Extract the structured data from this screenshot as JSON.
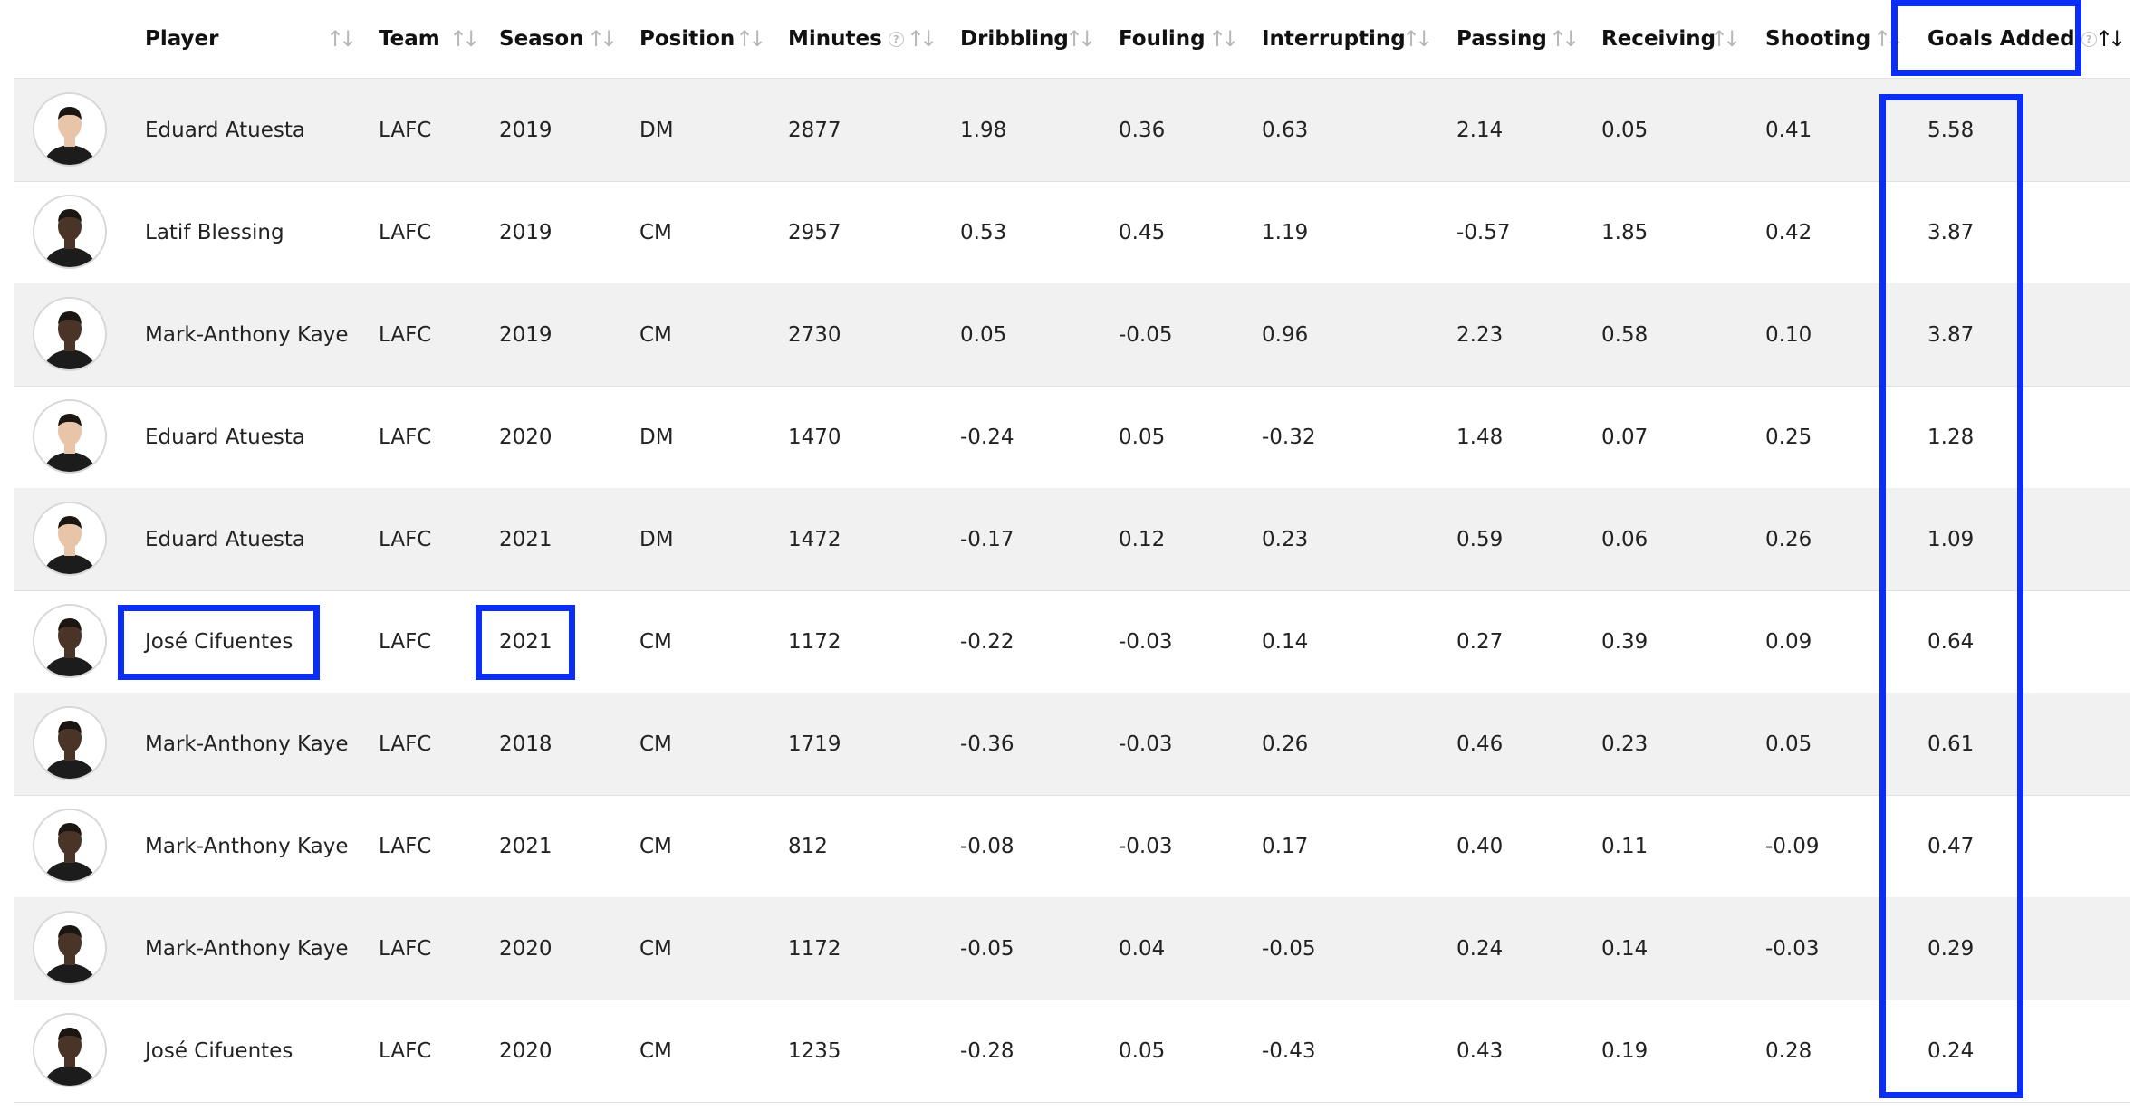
{
  "table": {
    "columns": [
      {
        "key": "player",
        "label": "Player",
        "info": false
      },
      {
        "key": "team",
        "label": "Team",
        "info": false
      },
      {
        "key": "season",
        "label": "Season",
        "info": false
      },
      {
        "key": "position",
        "label": "Position",
        "info": false
      },
      {
        "key": "minutes",
        "label": "Minutes",
        "info": true
      },
      {
        "key": "dribbling",
        "label": "Dribbling",
        "info": false
      },
      {
        "key": "fouling",
        "label": "Fouling",
        "info": false
      },
      {
        "key": "interrupting",
        "label": "Interrupting",
        "info": false
      },
      {
        "key": "passing",
        "label": "Passing",
        "info": false
      },
      {
        "key": "receiving",
        "label": "Receiving",
        "info": false
      },
      {
        "key": "shooting",
        "label": "Shooting",
        "info": false
      },
      {
        "key": "goals_added",
        "label": "Goals Added",
        "info": true
      }
    ],
    "sort_icon": "↑↓",
    "rows": [
      {
        "player": "Eduard Atuesta",
        "team": "LAFC",
        "season": "2019",
        "position": "DM",
        "minutes": "2877",
        "dribbling": "1.98",
        "fouling": "0.36",
        "interrupting": "0.63",
        "passing": "2.14",
        "receiving": "0.05",
        "shooting": "0.41",
        "goals_added": "5.58",
        "skin": "light"
      },
      {
        "player": "Latif Blessing",
        "team": "LAFC",
        "season": "2019",
        "position": "CM",
        "minutes": "2957",
        "dribbling": "0.53",
        "fouling": "0.45",
        "interrupting": "1.19",
        "passing": "-0.57",
        "receiving": "1.85",
        "shooting": "0.42",
        "goals_added": "3.87",
        "skin": "dark"
      },
      {
        "player": "Mark-Anthony Kaye",
        "team": "LAFC",
        "season": "2019",
        "position": "CM",
        "minutes": "2730",
        "dribbling": "0.05",
        "fouling": "-0.05",
        "interrupting": "0.96",
        "passing": "2.23",
        "receiving": "0.58",
        "shooting": "0.10",
        "goals_added": "3.87",
        "skin": "dark"
      },
      {
        "player": "Eduard Atuesta",
        "team": "LAFC",
        "season": "2020",
        "position": "DM",
        "minutes": "1470",
        "dribbling": "-0.24",
        "fouling": "0.05",
        "interrupting": "-0.32",
        "passing": "1.48",
        "receiving": "0.07",
        "shooting": "0.25",
        "goals_added": "1.28",
        "skin": "light"
      },
      {
        "player": "Eduard Atuesta",
        "team": "LAFC",
        "season": "2021",
        "position": "DM",
        "minutes": "1472",
        "dribbling": "-0.17",
        "fouling": "0.12",
        "interrupting": "0.23",
        "passing": "0.59",
        "receiving": "0.06",
        "shooting": "0.26",
        "goals_added": "1.09",
        "skin": "light"
      },
      {
        "player": "José Cifuentes",
        "team": "LAFC",
        "season": "2021",
        "position": "CM",
        "minutes": "1172",
        "dribbling": "-0.22",
        "fouling": "-0.03",
        "interrupting": "0.14",
        "passing": "0.27",
        "receiving": "0.39",
        "shooting": "0.09",
        "goals_added": "0.64",
        "skin": "dark"
      },
      {
        "player": "Mark-Anthony Kaye",
        "team": "LAFC",
        "season": "2018",
        "position": "CM",
        "minutes": "1719",
        "dribbling": "-0.36",
        "fouling": "-0.03",
        "interrupting": "0.26",
        "passing": "0.46",
        "receiving": "0.23",
        "shooting": "0.05",
        "goals_added": "0.61",
        "skin": "dark"
      },
      {
        "player": "Mark-Anthony Kaye",
        "team": "LAFC",
        "season": "2021",
        "position": "CM",
        "minutes": "812",
        "dribbling": "-0.08",
        "fouling": "-0.03",
        "interrupting": "0.17",
        "passing": "0.40",
        "receiving": "0.11",
        "shooting": "-0.09",
        "goals_added": "0.47",
        "skin": "dark"
      },
      {
        "player": "Mark-Anthony Kaye",
        "team": "LAFC",
        "season": "2020",
        "position": "CM",
        "minutes": "1172",
        "dribbling": "-0.05",
        "fouling": "0.04",
        "interrupting": "-0.05",
        "passing": "0.24",
        "receiving": "0.14",
        "shooting": "-0.03",
        "goals_added": "0.29",
        "skin": "dark"
      },
      {
        "player": "José Cifuentes",
        "team": "LAFC",
        "season": "2020",
        "position": "CM",
        "minutes": "1235",
        "dribbling": "-0.28",
        "fouling": "0.05",
        "interrupting": "-0.43",
        "passing": "0.43",
        "receiving": "0.19",
        "shooting": "0.28",
        "goals_added": "0.24",
        "skin": "dark"
      }
    ]
  },
  "colors": {
    "highlight": "#0a2ef5",
    "row_shade": "#f1f1f1",
    "skin_light": "#e8c4a8",
    "skin_dark": "#4a3428",
    "hair_dark": "#1b1612",
    "shirt": "#1c1c1c"
  }
}
